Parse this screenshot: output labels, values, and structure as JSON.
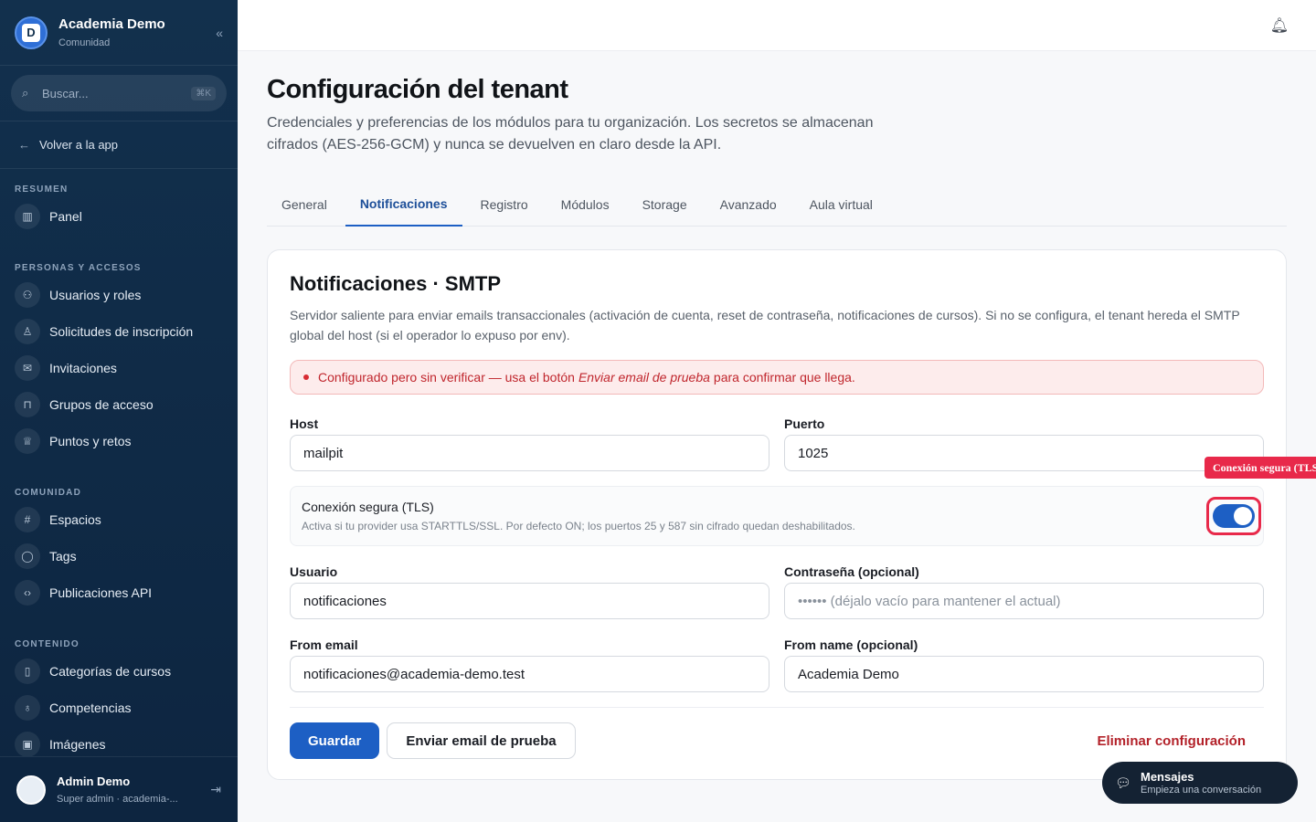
{
  "brand": {
    "title": "Academia Demo",
    "subtitle": "Comunidad",
    "logo_letter": "D"
  },
  "search": {
    "placeholder": "Buscar...",
    "shortcut": "⌘K"
  },
  "back_link": "Volver a la app",
  "sidebar": {
    "sections": [
      {
        "label": "RESUMEN",
        "items": [
          {
            "label": "Panel",
            "icon": "chart-icon"
          }
        ]
      },
      {
        "label": "PERSONAS Y ACCESOS",
        "items": [
          {
            "label": "Usuarios y roles",
            "icon": "users-icon"
          },
          {
            "label": "Solicitudes de inscripción",
            "icon": "user-icon"
          },
          {
            "label": "Invitaciones",
            "icon": "mail-icon"
          },
          {
            "label": "Grupos de acceso",
            "icon": "lock-icon"
          },
          {
            "label": "Puntos y retos",
            "icon": "trophy-icon"
          }
        ]
      },
      {
        "label": "COMUNIDAD",
        "items": [
          {
            "label": "Espacios",
            "icon": "hash-icon"
          },
          {
            "label": "Tags",
            "icon": "chat-icon"
          },
          {
            "label": "Publicaciones API",
            "icon": "code-icon"
          }
        ]
      },
      {
        "label": "CONTENIDO",
        "items": [
          {
            "label": "Categorías de cursos",
            "icon": "book-icon"
          },
          {
            "label": "Competencias",
            "icon": "badge-icon"
          },
          {
            "label": "Imágenes",
            "icon": "image-icon"
          }
        ]
      }
    ]
  },
  "user": {
    "name": "Admin Demo",
    "role": "Super admin · academia-..."
  },
  "page": {
    "title": "Configuración del tenant",
    "description": "Credenciales y preferencias de los módulos para tu organización. Los secretos se almacenan cifrados (AES-256-GCM) y nunca se devuelven en claro desde la API."
  },
  "tabs": [
    "General",
    "Notificaciones",
    "Registro",
    "Módulos",
    "Storage",
    "Avanzado",
    "Aula virtual"
  ],
  "active_tab": "Notificaciones",
  "card": {
    "title": "Notificaciones · SMTP",
    "description": "Servidor saliente para enviar emails transaccionales (activación de cuenta, reset de contraseña, notificaciones de cursos). Si no se configura, el tenant hereda el SMTP global del host (si el operador lo expuso por env).",
    "alert": {
      "before": "Configurado pero sin verificar — usa el botón",
      "emphasis": "Enviar email de prueba",
      "after": "para confirmar que llega."
    },
    "host": {
      "label": "Host",
      "value": "mailpit"
    },
    "port": {
      "label": "Puerto",
      "value": "1025"
    },
    "tls": {
      "title": "Conexión segura (TLS)",
      "description": "Activa si tu provider usa STARTTLS/SSL. Por defecto ON; los puertos 25 y 587 sin cifrado quedan deshabilitados.",
      "enabled": true,
      "tooltip": "Conexión segura (TLS)"
    },
    "username": {
      "label": "Usuario",
      "value": "notificaciones"
    },
    "password": {
      "label": "Contraseña (opcional)",
      "placeholder": "•••••• (déjalo vacío para mantener el actual)"
    },
    "from_email": {
      "label": "From email",
      "value": "notificaciones@academia-demo.test"
    },
    "from_name": {
      "label": "From name (opcional)",
      "value": "Academia Demo"
    },
    "buttons": {
      "save": "Guardar",
      "test": "Enviar email de prueba",
      "delete": "Eliminar configuración"
    }
  },
  "messages": {
    "title": "Mensajes",
    "subtitle": "Empieza una conversación"
  },
  "colors": {
    "primary": "#1d5fc4",
    "sidebar": "#12304d",
    "danger": "#b3222a",
    "highlight": "#e8294a"
  }
}
